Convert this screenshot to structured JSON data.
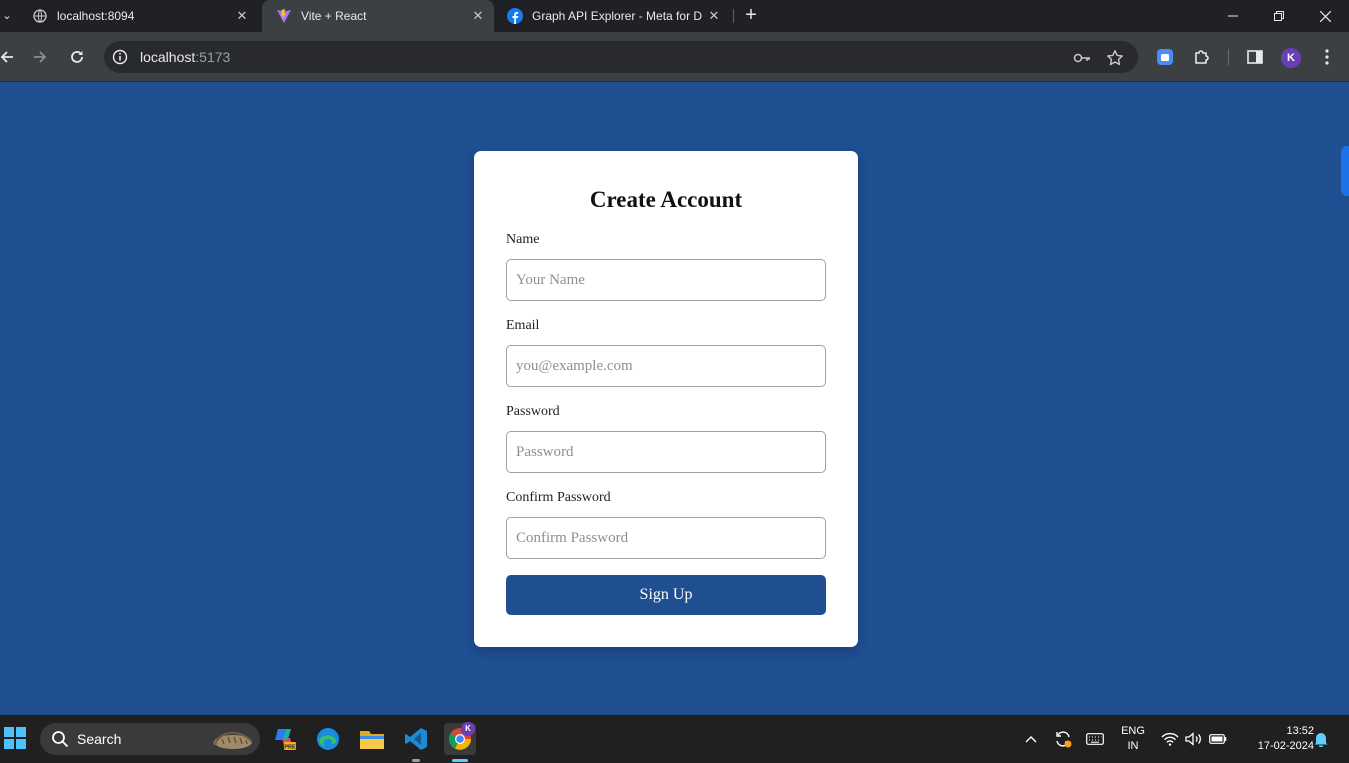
{
  "browser": {
    "tabs": [
      {
        "title": "localhost:8094",
        "close": "✕"
      },
      {
        "title": "Vite + React",
        "close": "✕"
      },
      {
        "title": "Graph API Explorer - Meta for D",
        "close": "✕"
      }
    ],
    "new_tab": "+",
    "url_host": "localhost",
    "url_port": ":5173",
    "profile_initial": "K"
  },
  "form": {
    "title": "Create Account",
    "fields": [
      {
        "label": "Name",
        "placeholder": "Your Name"
      },
      {
        "label": "Email",
        "placeholder": "you@example.com"
      },
      {
        "label": "Password",
        "placeholder": "Password"
      },
      {
        "label": "Confirm Password",
        "placeholder": "Confirm Password"
      }
    ],
    "submit_label": "Sign Up"
  },
  "taskbar": {
    "search_label": "Search",
    "chrome_badge": "K",
    "lang_line1": "ENG",
    "lang_line2": "IN",
    "time": "13:52",
    "date": "17-02-2024"
  },
  "colors": {
    "page_background": "#1f4e91",
    "button": "#1f4e91",
    "card": "#ffffff"
  }
}
